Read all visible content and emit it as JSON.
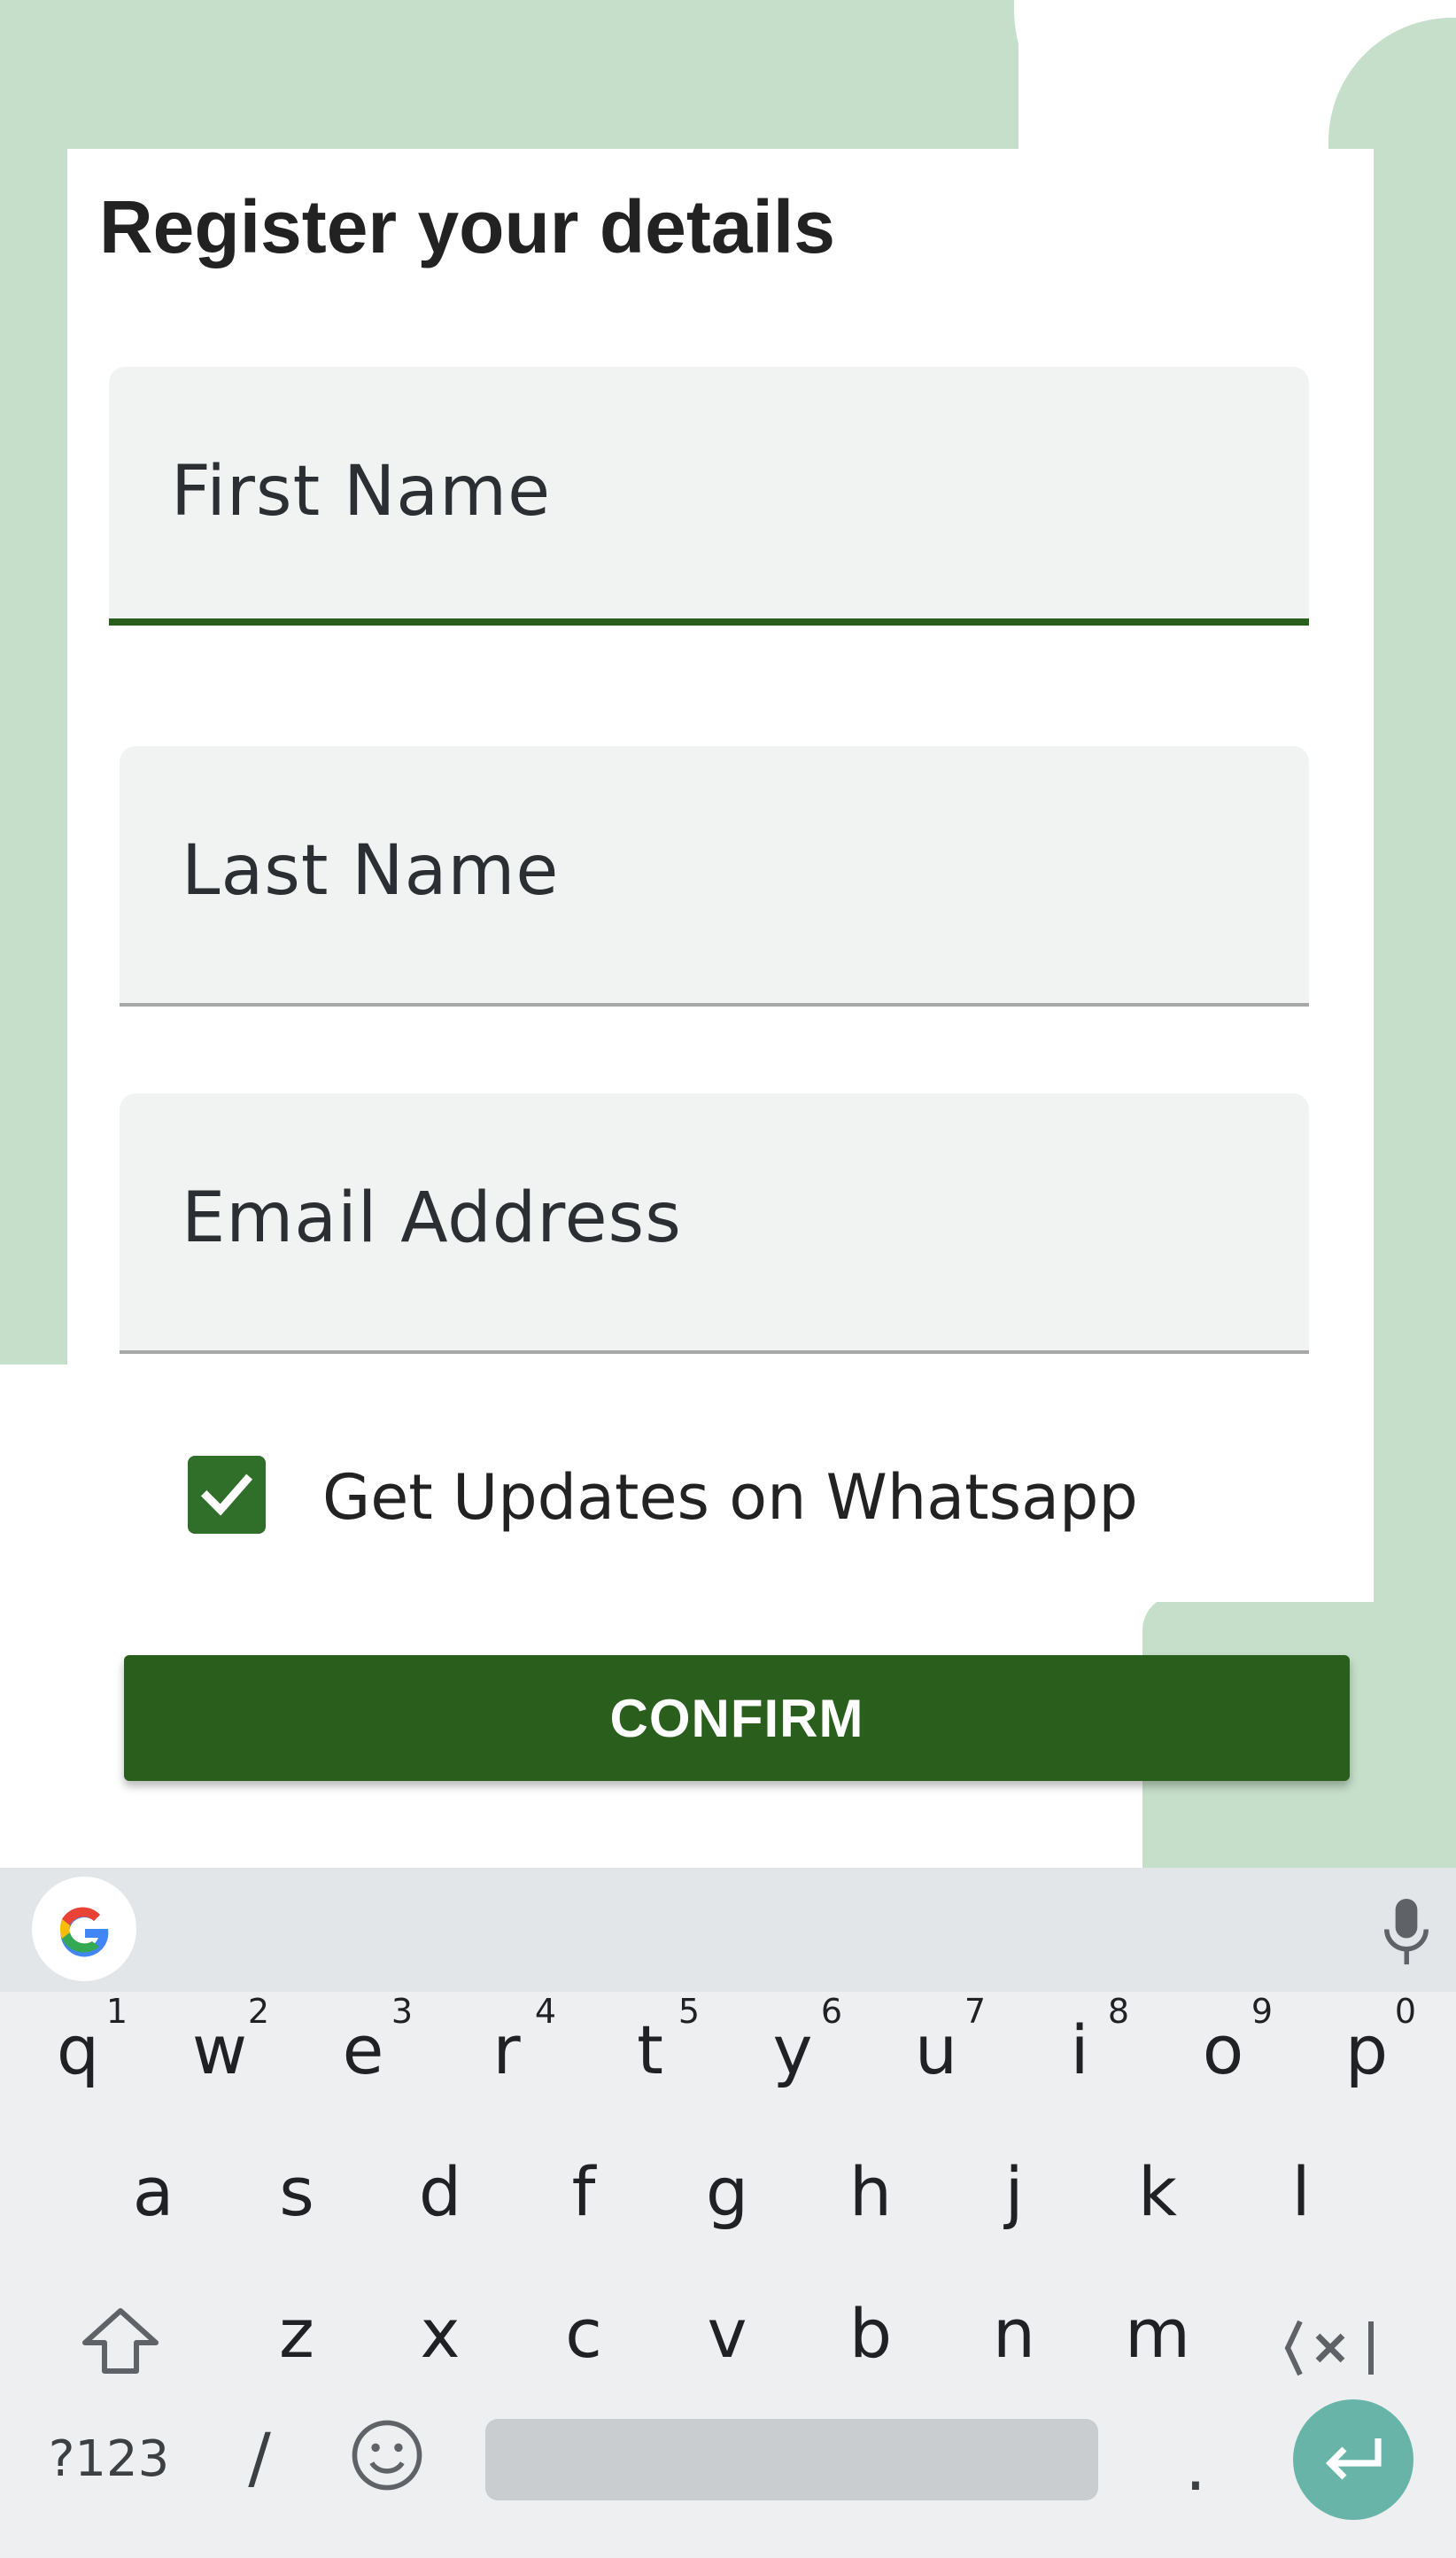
{
  "form": {
    "title": "Register your details",
    "first_name_placeholder": "First Name",
    "last_name_placeholder": "Last Name",
    "email_placeholder": "Email Address",
    "whatsapp_label": "Get Updates on Whatsapp",
    "whatsapp_checked": true,
    "confirm_label": "CONFIRM"
  },
  "keyboard": {
    "row1": [
      {
        "k": "q",
        "hint": "1"
      },
      {
        "k": "w",
        "hint": "2"
      },
      {
        "k": "e",
        "hint": "3"
      },
      {
        "k": "r",
        "hint": "4"
      },
      {
        "k": "t",
        "hint": "5"
      },
      {
        "k": "y",
        "hint": "6"
      },
      {
        "k": "u",
        "hint": "7"
      },
      {
        "k": "i",
        "hint": "8"
      },
      {
        "k": "o",
        "hint": "9"
      },
      {
        "k": "p",
        "hint": "0"
      }
    ],
    "row2": [
      "a",
      "s",
      "d",
      "f",
      "g",
      "h",
      "j",
      "k",
      "l"
    ],
    "row3": [
      "z",
      "x",
      "c",
      "v",
      "b",
      "n",
      "m"
    ],
    "symbols_key": "?123",
    "slash_key": "/",
    "period_key": "."
  },
  "colors": {
    "accent": "#2a5e1d",
    "background_shape": "#c5dfca",
    "enter_key": "#68b4a8"
  },
  "icons": [
    "google-icon",
    "mic-icon",
    "shift-icon",
    "backspace-icon",
    "emoji-icon",
    "enter-icon",
    "checkmark-icon"
  ]
}
